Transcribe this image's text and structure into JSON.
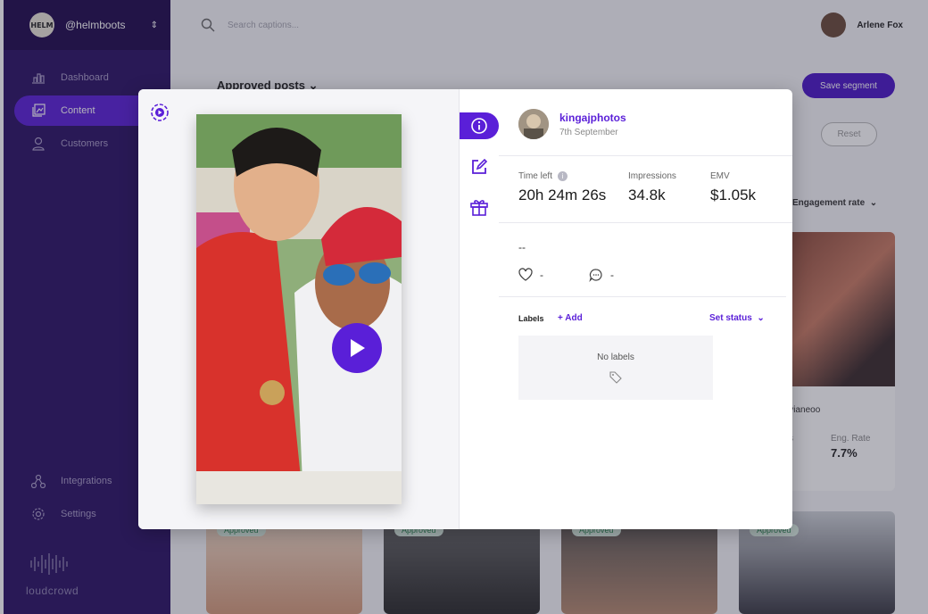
{
  "account": {
    "logo_text": "HELM",
    "handle": "@helmboots"
  },
  "nav": {
    "items": [
      {
        "label": "Dashboard",
        "icon": "chart-icon"
      },
      {
        "label": "Content",
        "icon": "content-icon"
      },
      {
        "label": "Customers",
        "icon": "user-icon"
      }
    ],
    "bottom": [
      {
        "label": "Integrations",
        "icon": "integrations-icon"
      },
      {
        "label": "Settings",
        "icon": "gear-icon"
      }
    ]
  },
  "brand": {
    "name": "loudcrowd"
  },
  "search": {
    "placeholder": "Search captions..."
  },
  "user": {
    "name": "Arlene Fox"
  },
  "page": {
    "title": "Approved posts",
    "save_segment": "Save segment",
    "reset": "Reset",
    "sort_label": "Engagement rate"
  },
  "background_card": {
    "username": "vivianeoo",
    "metric_label_partial": "ons",
    "eng_rate_label": "Eng. Rate",
    "eng_rate_value": "7.7%"
  },
  "tiles": [
    {
      "badge": "Approved"
    },
    {
      "badge": "Approved"
    },
    {
      "badge": "Approved"
    },
    {
      "badge": "Approved"
    }
  ],
  "modal": {
    "profile": {
      "username": "kingajphotos",
      "date": "7th September"
    },
    "stats": [
      {
        "label": "Time left",
        "value": "20h 24m 26s",
        "info": "i"
      },
      {
        "label": "Impressions",
        "value": "34.8k"
      },
      {
        "label": "EMV",
        "value": "$1.05k"
      }
    ],
    "caption": "--",
    "likes": "-",
    "comments": "-",
    "labels": {
      "heading": "Labels",
      "add": "+ Add",
      "set_status": "Set status",
      "empty": "No labels"
    }
  },
  "colors": {
    "accent": "#5a1fd8",
    "sidebar": "#2a1164"
  }
}
